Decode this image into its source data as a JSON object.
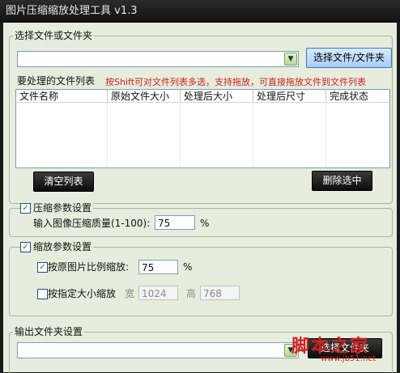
{
  "window": {
    "title": "图片压缩缩放处理工具 v1.3"
  },
  "file_select": {
    "group_label": "选择文件或文件夹",
    "combo_value": "",
    "select_button": "选择文件/文件夹",
    "list_label": "要处理的文件列表",
    "hint": "按Shift可对文件列表多选，支持拖放，可直接拖放文件到文件列表",
    "columns": [
      "文件名称",
      "原始文件大小",
      "处理后大小",
      "处理后尺寸",
      "完成状态"
    ],
    "rows": [],
    "clear_button": "清空列表",
    "delete_button": "删除选中"
  },
  "compression": {
    "enabled": true,
    "group_label": "压缩参数设置",
    "quality_label": "输入图像压缩质量(1-100):",
    "quality_value": "75",
    "unit": "%"
  },
  "scaling": {
    "enabled": true,
    "group_label": "缩放参数设置",
    "ratio_enabled": true,
    "ratio_label": "按原图片比例缩放:",
    "ratio_value": "75",
    "ratio_unit": "%",
    "size_enabled": false,
    "size_label": "按指定大小缩放",
    "width_label": "宽",
    "width_value": "1024",
    "height_label": "高",
    "height_value": "768"
  },
  "output": {
    "group_label": "输出文件夹设置",
    "combo_value": "",
    "select_button": "选择文件夹"
  },
  "watermark": {
    "text": "脚本之家",
    "url": "www.jb51.net"
  },
  "colors": {
    "panel": "#e6eddd",
    "hint": "#d02020",
    "button_blue": "#a9cdf5",
    "button_dark": "#0c0c0c"
  }
}
